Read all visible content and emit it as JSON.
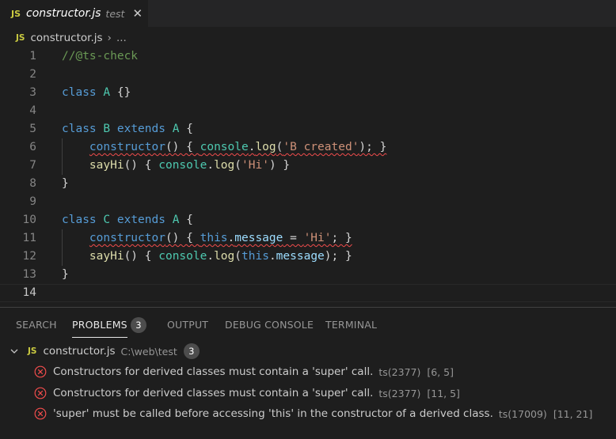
{
  "tab": {
    "icon": "JS",
    "title": "constructor.js",
    "description": "test",
    "close": "✕"
  },
  "breadcrumb": {
    "icon": "JS",
    "file": "constructor.js",
    "separator": "›",
    "more": "..."
  },
  "editor": {
    "line_numbers": [
      "1",
      "2",
      "3",
      "4",
      "5",
      "6",
      "7",
      "8",
      "9",
      "10",
      "11",
      "12",
      "13",
      "14"
    ],
    "tokens": {
      "l1_comment": "//@ts-check",
      "class_kw": "class",
      "extends_kw": "extends",
      "A": "A",
      "B": "B",
      "C": "C",
      "empty_body": " {}",
      "open_brace": " {",
      "close_brace": "}",
      "constructor": "constructor",
      "sayHi": "sayHi",
      "parens_open": "() { ",
      "console": "console",
      "dot": ".",
      "log": "log",
      "lparen": "(",
      "b_created": "'B created'",
      "hi": "'Hi'",
      "end_stmt": "); }",
      "end_stmt_short": ") }",
      "this": "this",
      "message": "message",
      "assign": " = ",
      "semi_close": "; }"
    }
  },
  "panel": {
    "tabs": {
      "search": "SEARCH",
      "problems": "PROBLEMS",
      "problems_count": "3",
      "output": "OUTPUT",
      "debug_console": "DEBUG CONSOLE",
      "terminal": "TERMINAL"
    },
    "file": {
      "icon": "JS",
      "name": "constructor.js",
      "path": "C:\\web\\test",
      "count": "3"
    },
    "problems": [
      {
        "message": "Constructors for derived classes must contain a 'super' call.",
        "source": "ts(2377)",
        "position": "[6, 5]"
      },
      {
        "message": "Constructors for derived classes must contain a 'super' call.",
        "source": "ts(2377)",
        "position": "[11, 5]"
      },
      {
        "message": "'super' must be called before accessing 'this' in the constructor of a derived class.",
        "source": "ts(17009)",
        "position": "[11, 21]"
      }
    ]
  },
  "colors": {
    "error": "#f14c4c",
    "js_icon": "#cbcb41",
    "keyword": "#569cd6",
    "class": "#4ec9b0",
    "string": "#ce9178"
  }
}
